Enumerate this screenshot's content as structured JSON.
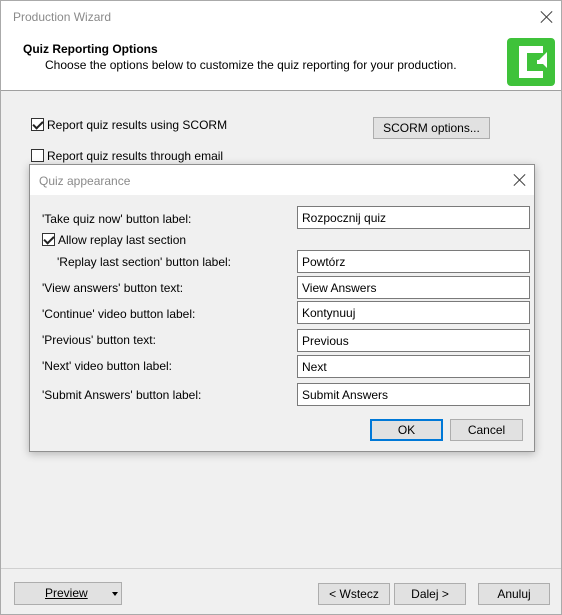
{
  "window": {
    "title": "Production Wizard"
  },
  "header": {
    "title": "Quiz Reporting Options",
    "subtitle": "Choose the options below to customize the quiz reporting for your production.",
    "logo_color": "#3fc23a"
  },
  "main": {
    "scorm_checkbox_label": "Report quiz results using SCORM",
    "scorm_checked": true,
    "scorm_options_button": "SCORM options...",
    "email_checkbox_label": "Report quiz results through email",
    "email_checked": false
  },
  "dialog": {
    "title": "Quiz appearance",
    "rows": {
      "take_quiz_label": "'Take quiz now' button label:",
      "take_quiz_value": "Rozpocznij quiz",
      "allow_replay_label": "Allow replay last section",
      "allow_replay_checked": true,
      "replay_label": "'Replay last section' button label:",
      "replay_value": "Powtórz",
      "view_answers_label": "'View answers' button text:",
      "view_answers_value": "View Answers",
      "continue_label": "'Continue' video button label:",
      "continue_value": "Kontynuuj",
      "previous_label": "'Previous' button text:",
      "previous_value": "Previous",
      "next_label": "'Next' video button label:",
      "next_value": "Next",
      "submit_label": "'Submit Answers' button label:",
      "submit_value": "Submit Answers"
    },
    "ok_button": "OK",
    "cancel_button": "Cancel"
  },
  "footer": {
    "preview_button": "Preview",
    "back_button": "< Wstecz",
    "next_button": "Dalej >",
    "cancel_button": "Anuluj"
  }
}
